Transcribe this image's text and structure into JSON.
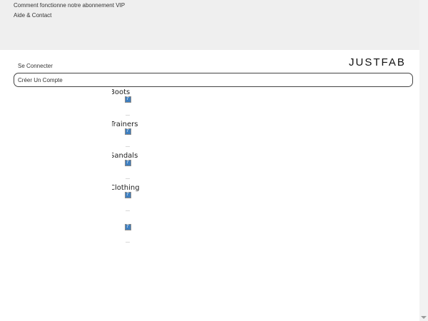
{
  "header": {
    "links": [
      "Comment fonctionne notre abonnement VIP",
      "Aide & Contact"
    ]
  },
  "account": {
    "logo_text": "JUSTFAB",
    "signin_label": "Se Connecter",
    "create_account_label": "Créer Un Compte"
  },
  "categories": [
    {
      "label": "Boots"
    },
    {
      "label": "Trainers"
    },
    {
      "label": "Sandals"
    },
    {
      "label": "Clothing"
    },
    {
      "label": ""
    }
  ]
}
